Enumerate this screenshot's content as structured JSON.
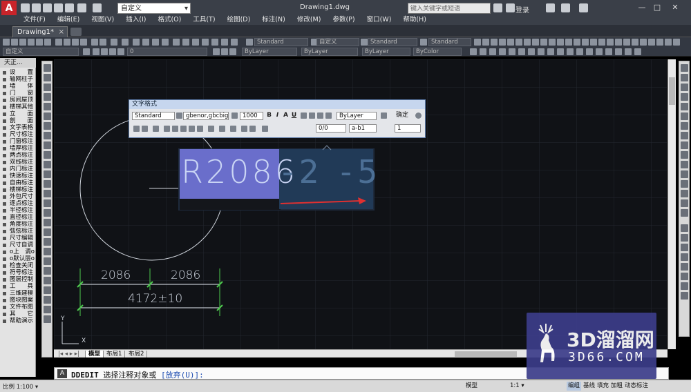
{
  "titlebar": {
    "workspace": "自定义",
    "title": "Drawing1.dwg",
    "search_placeholder": "键入关键字或短语",
    "login": "登录",
    "controls": [
      "—",
      "□",
      "✕"
    ]
  },
  "menus": [
    "文件(F)",
    "编辑(E)",
    "视图(V)",
    "插入(I)",
    "格式(O)",
    "工具(T)",
    "绘图(D)",
    "标注(N)",
    "修改(M)",
    "参数(P)",
    "窗口(W)",
    "帮助(H)"
  ],
  "doc_tab": {
    "label": "Drawing1*",
    "close": "×"
  },
  "toolbar1": {
    "text_style": "Standard",
    "workspace2": "自定义",
    "dim_style": "Standard",
    "table_style": "Standard",
    "multileader_style": "Standard"
  },
  "toolbar2": {
    "layer_workspace": "自定义",
    "layer_value": "0",
    "color": "ByLayer",
    "linetype": "ByLayer",
    "lineweight": "ByLayer",
    "plotstyle": "ByColor"
  },
  "palette": {
    "title": "天正...",
    "items": [
      "设　　置",
      "轴网柱子",
      "墙　　体",
      "门　　窗",
      "房间屋顶",
      "楼梯其他",
      "立　　面",
      "剖　　面",
      "文字表格",
      "尺寸标注",
      "门窗标注",
      "墙厚标注",
      "两点标注",
      "双线标注",
      "内门标注",
      "快速标注",
      "自由标注",
      "楼梯标注",
      "外包尺寸",
      "逐点标注",
      "半径标注",
      "直径标注",
      "角度标注",
      "弧弦标注",
      "尺寸编辑",
      "尺寸自调",
      "o上　调o",
      "o默认层o",
      "检查关闭",
      "符号标注",
      "图层控制",
      "工　　具",
      "三维建模",
      "图块图案",
      "文件布图",
      "其　　它",
      "帮助演示"
    ]
  },
  "text_format": {
    "title": "文字格式",
    "style": "Standard",
    "font": "gbenor,gbcbig",
    "height": "1000",
    "bold": "B",
    "italic": "I",
    "overline": "A",
    "underline": "U",
    "color": "ByLayer",
    "ok": "确定",
    "oblique": "0/0",
    "tracking": "a-b1",
    "width": "1"
  },
  "mtext": {
    "selected": "R2086",
    "rest": "-2 -5"
  },
  "dimensions": {
    "left": "2086",
    "right": "2086",
    "total": "4172±10"
  },
  "layout_tabs": [
    "模型",
    "布局1",
    "布局2"
  ],
  "command": {
    "icon": "A",
    "name": "DDEDIT",
    "prompt": "选择注释对象或",
    "option": "[放弃(U)]:"
  },
  "statusbar": {
    "scale": "比例 1:100 ▾",
    "buttons": [
      "模型",
      "1:1 ▾",
      "编组",
      "基线",
      "填充",
      "加粗",
      "动态标注"
    ]
  },
  "watermark": {
    "title": "3D溜溜网",
    "subtitle": "3D66.COM"
  }
}
